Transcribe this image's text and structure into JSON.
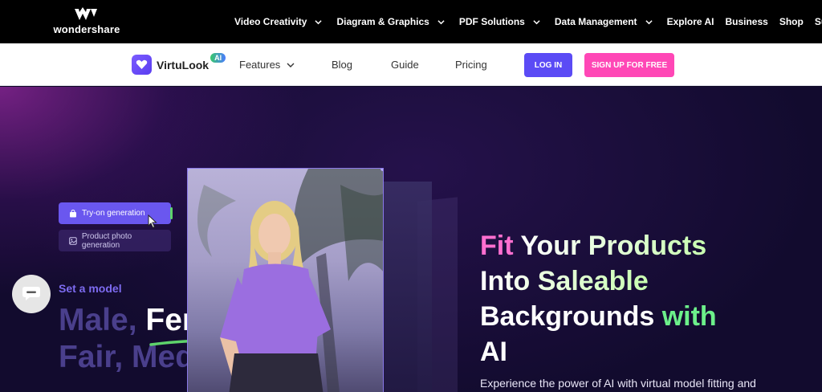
{
  "topbar": {
    "brand": "wondershare",
    "nav": [
      {
        "label": "Video Creativity",
        "has_menu": true
      },
      {
        "label": "Diagram & Graphics",
        "has_menu": true
      },
      {
        "label": "PDF Solutions",
        "has_menu": true
      },
      {
        "label": "Data Management",
        "has_menu": true
      },
      {
        "label": "Explore AI",
        "has_menu": false
      },
      {
        "label": "Business",
        "has_menu": false
      },
      {
        "label": "Shop",
        "has_menu": false
      },
      {
        "label": "Support",
        "has_menu": false
      }
    ]
  },
  "subbar": {
    "product_name": "VirtuLook",
    "product_badge": "AI",
    "nav": {
      "features": "Features",
      "blog": "Blog",
      "guide": "Guide",
      "pricing": "Pricing"
    },
    "login_label": "LOG IN",
    "signup_label": "SIGN UP FOR FREE"
  },
  "hero": {
    "tabs": {
      "try_on": "Try-on generation",
      "product_photo": "Product photo generation"
    },
    "set_model": "Set a model",
    "words_line1_a": "Male, ",
    "words_line1_b": "Female,",
    "words_line2": "Fair, Medium,",
    "headline": {
      "line1_a": "Fit ",
      "line1_b": "Your Products",
      "line2": "Into Saleable",
      "line3_a": "Backgrounds ",
      "line3_b": "with",
      "line4": "AI"
    },
    "description": "Experience the power of AI with virtual model fitting and"
  },
  "colors": {
    "login_button": "#5b4bf5",
    "signup_button": "#ff47b6",
    "accent_pink": "#ff6fd0",
    "accent_green": "#6cf08a",
    "tab_active": "#6a57ef"
  },
  "icons": [
    "wondershare-logo-icon",
    "chevron-down-icon",
    "virtulook-logo-icon",
    "shopping-bag-icon",
    "image-icon",
    "chat-icon",
    "pointer-cursor-icon"
  ]
}
